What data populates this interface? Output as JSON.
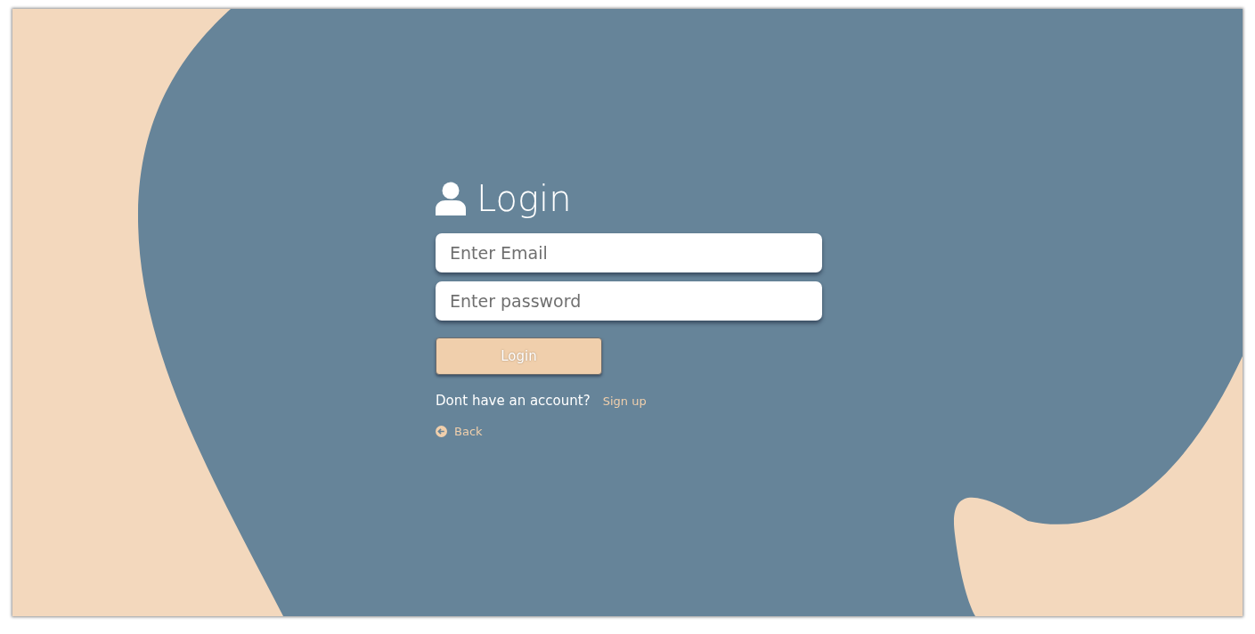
{
  "title": "Login",
  "email_field": {
    "placeholder": "Enter Email"
  },
  "password_field": {
    "placeholder": "Enter password"
  },
  "submit": "Login",
  "signup": {
    "prompt": "Dont have an account?",
    "link": "Sign up"
  },
  "back": "Back"
}
